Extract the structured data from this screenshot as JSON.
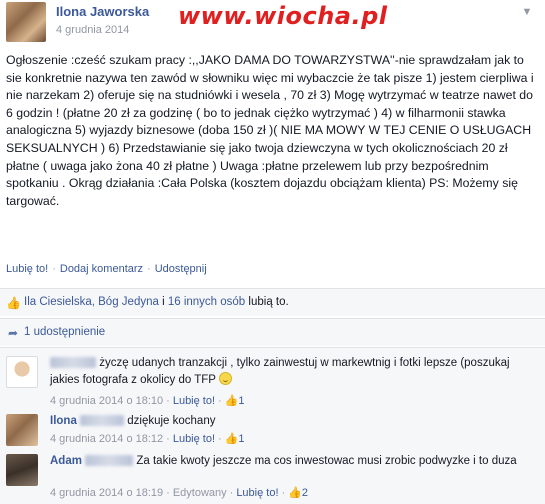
{
  "post": {
    "author": "Ilona Jaworska",
    "date": "4 grudnia 2014",
    "watermark": "www.wiocha.pl",
    "body": "Ogłoszenie :cześć szukam pracy :,,JAKO DAMA DO TOWARZYSTWA''-nie sprawdzałam jak to sie konkretnie nazywa ten zawód w słowniku więc mi wybaczcie że tak pisze 1) jestem cierpliwa i nie narzekam 2) oferuje się na studniówki i wesela , 70 zł 3) Mogę wytrzymać w teatrze nawet do 6 godzin ! (płatne 20 zł za godzinę ( bo to jednak ciężko wytrzymać ) 4) w filharmonii stawka analogiczna 5) wyjazdy biznesowe (doba 150 zł )( NIE MA MOWY W TEJ CENIE O USŁUGACH SEKSUALNYCH ) 6) Przedstawianie się jako twoja dziewczyna w tych okolicznościach 20 zł płatne ( uwaga jako żona 40 zł płatne ) Uwaga :płatne przelewem lub przy bezpośrednim spotkaniu . Okrąg działania :Cała Polska (kosztem dojazdu obciążam klienta) PS: Możemy się targować."
  },
  "actions": {
    "like": "Lubię to!",
    "comment": "Dodaj komentarz",
    "share": "Udostępnij",
    "separator": "·"
  },
  "likes_bar": {
    "names": "Ila Ciesielska, Bóg Jedyna",
    "rest_prefix": " i ",
    "others": "16 innych osób",
    "suffix": " lubią to."
  },
  "shares_bar": {
    "text": "1 udostępnienie"
  },
  "comments": [
    {
      "name": "",
      "text": "życzę udanych tranzakcji , tylko zainwestuj w markewtnig i fotki lepsze (poszukaj jakies fotografa z okolicy do TFP",
      "date": "4 grudnia 2014 o 18:10",
      "like": "Lubię to!",
      "likes": "1"
    },
    {
      "name": "Ilona",
      "text": "dziękuje kochany",
      "date": "4 grudnia 2014 o 18:12",
      "like": "Lubię to!",
      "likes": "1"
    },
    {
      "name": "Adam",
      "text": "Za takie kwoty jeszcze ma cos inwestowac musi zrobic podwyzke i to duza",
      "date": "4 grudnia 2014 o 18:19",
      "edited": "Edytowany",
      "like": "Lubię to!",
      "likes": "2"
    }
  ],
  "icons": {
    "chevron": "chevron-down-icon",
    "like": "thumbs-up-icon",
    "share": "share-icon"
  },
  "colors": {
    "link": "#3b5998",
    "meta": "#9197a3",
    "bar_bg": "#f6f7f9",
    "watermark": "#e02020"
  }
}
